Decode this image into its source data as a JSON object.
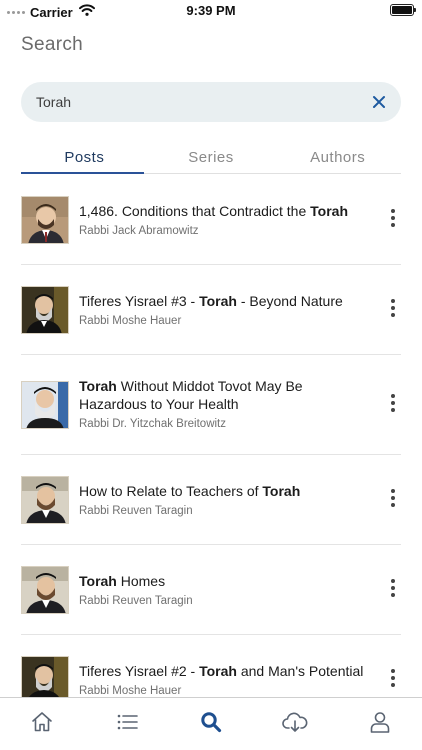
{
  "status_bar": {
    "carrier": "Carrier",
    "time": "9:39 PM"
  },
  "page": {
    "title": "Search"
  },
  "search": {
    "value": "Torah",
    "placeholder": ""
  },
  "tabs": [
    {
      "label": "Posts",
      "active": true
    },
    {
      "label": "Series",
      "active": false
    },
    {
      "label": "Authors",
      "active": false
    }
  ],
  "results": [
    {
      "title_parts": [
        [
          "1,486. Conditions that Contradict the ",
          false
        ],
        [
          "Torah",
          true
        ]
      ],
      "author": "Rabbi Jack Abramowitz"
    },
    {
      "title_parts": [
        [
          "Tiferes Yisrael #3 - ",
          false
        ],
        [
          "Torah",
          true
        ],
        [
          " - Beyond Nature",
          false
        ]
      ],
      "author": "Rabbi Moshe Hauer"
    },
    {
      "title_parts": [
        [
          "Torah",
          true
        ],
        [
          " Without Middot Tovot May Be Hazardous to Your Health",
          false
        ]
      ],
      "author": "Rabbi Dr. Yitzchak Breitowitz"
    },
    {
      "title_parts": [
        [
          "How to Relate to Teachers of ",
          false
        ],
        [
          "Torah",
          true
        ]
      ],
      "author": "Rabbi Reuven Taragin"
    },
    {
      "title_parts": [
        [
          "Torah",
          true
        ],
        [
          " Homes",
          false
        ]
      ],
      "author": "Rabbi Reuven Taragin"
    },
    {
      "title_parts": [
        [
          "Tiferes Yisrael #2 - ",
          false
        ],
        [
          "Torah",
          true
        ],
        [
          " and Man's Potential",
          false
        ]
      ],
      "author": "Rabbi Moshe Hauer"
    }
  ],
  "bottom_nav": [
    {
      "icon": "home-icon",
      "active": false
    },
    {
      "icon": "list-icon",
      "active": false
    },
    {
      "icon": "search-icon",
      "active": true
    },
    {
      "icon": "cloud-download-icon",
      "active": false
    },
    {
      "icon": "profile-icon",
      "active": false
    }
  ],
  "colors": {
    "accent": "#2a5298",
    "active_tab_text": "#1f3a5f",
    "search_bg": "#e9eff1",
    "clear_icon": "#1e5aa0"
  }
}
